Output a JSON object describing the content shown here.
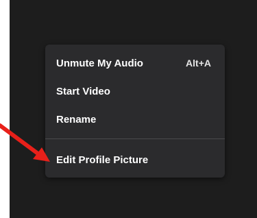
{
  "menu": {
    "items": [
      {
        "label": "Unmute My Audio",
        "shortcut": "Alt+A"
      },
      {
        "label": "Start Video"
      },
      {
        "label": "Rename"
      },
      {
        "label": "Edit Profile Picture"
      }
    ]
  },
  "annotation": {
    "arrow_color": "#e8201a",
    "arrow_icon": "red-pointer-arrow"
  },
  "colors": {
    "background": "#1d1d1d",
    "menu_background": "#2b2b2d",
    "text": "#ffffff"
  }
}
